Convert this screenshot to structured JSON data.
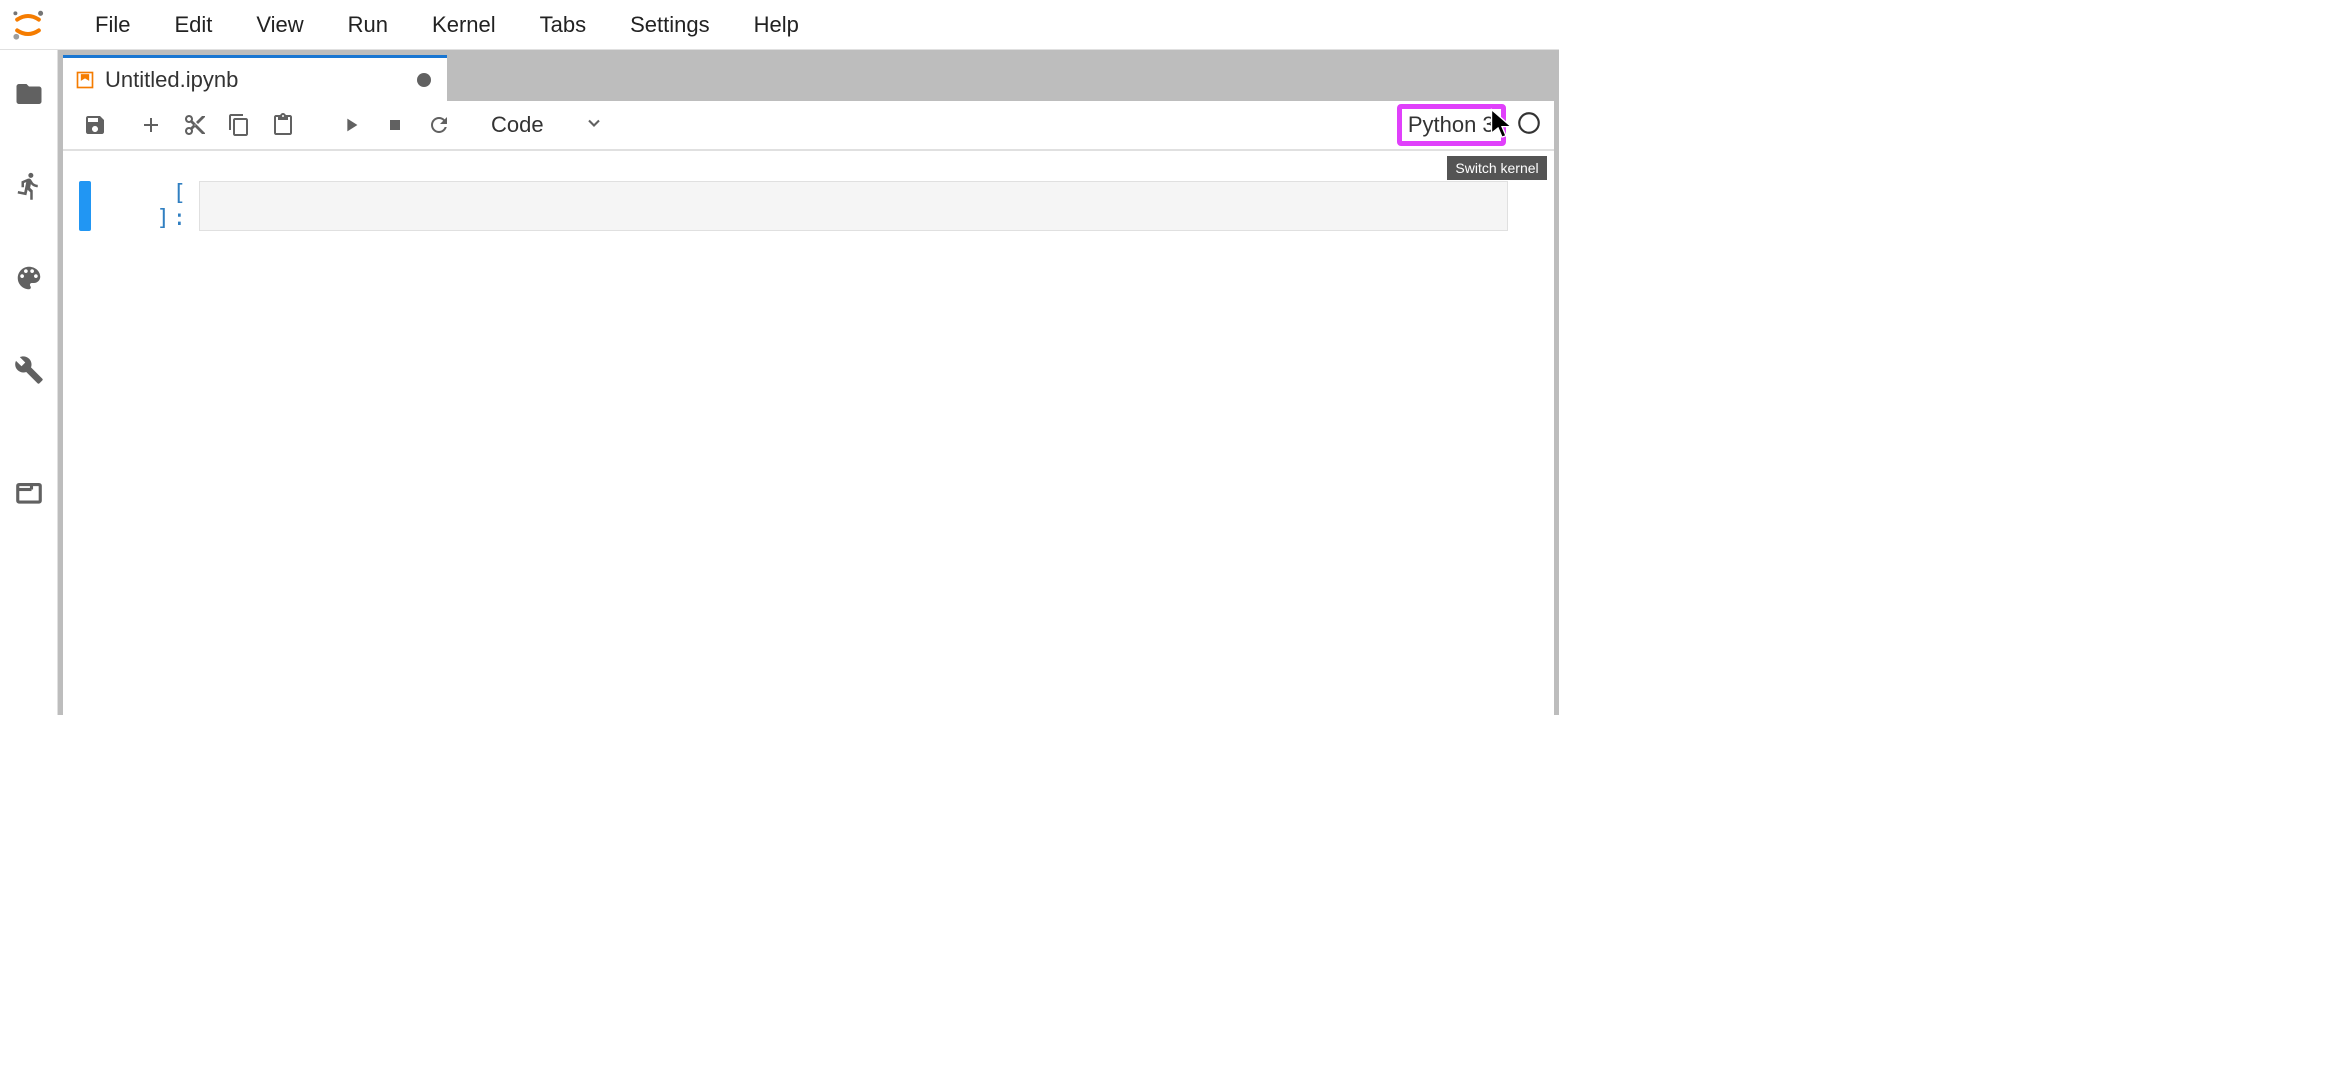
{
  "menu": {
    "items": [
      "File",
      "Edit",
      "View",
      "Run",
      "Kernel",
      "Tabs",
      "Settings",
      "Help"
    ]
  },
  "tab": {
    "label": "Untitled.ipynb",
    "dirty": true
  },
  "toolbar": {
    "cell_type": "Code",
    "kernel_name": "Python 3",
    "tooltip": "Switch kernel"
  },
  "cell": {
    "prompt": "[ ]:"
  },
  "highlight_color": "#e040fb"
}
